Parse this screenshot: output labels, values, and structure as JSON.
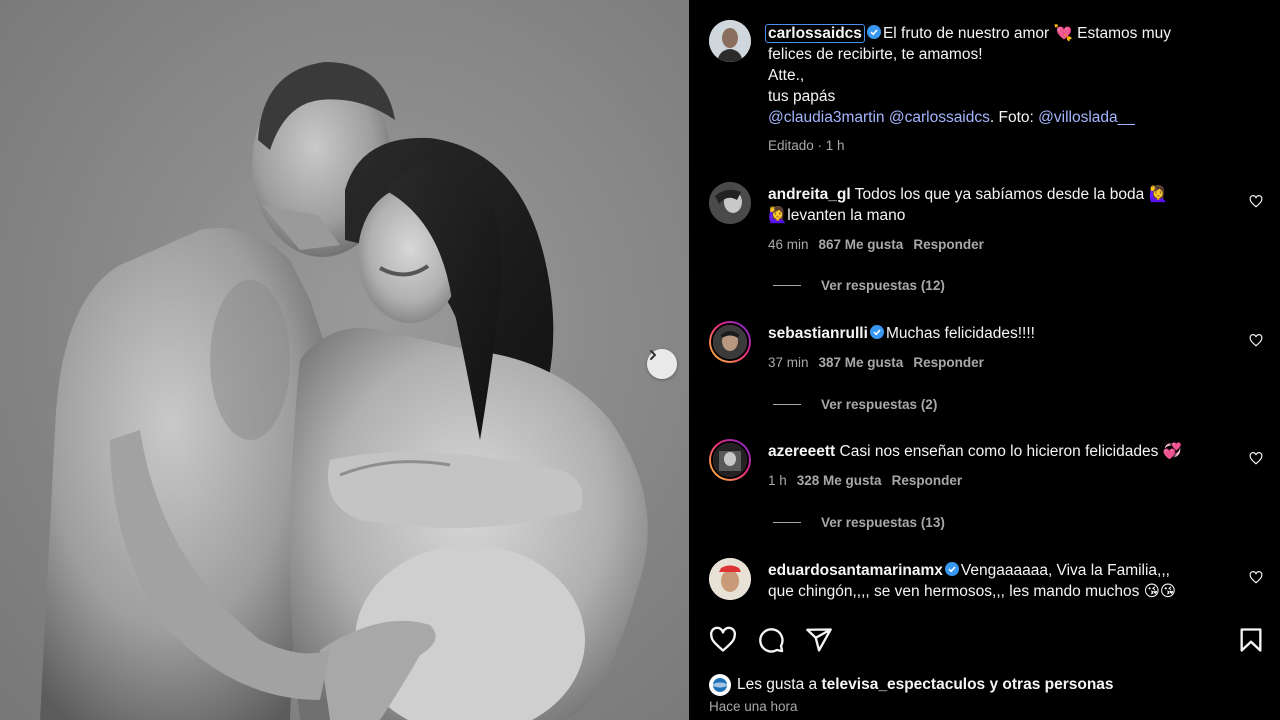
{
  "post": {
    "author": "carlossaidcs",
    "caption_lines": [
      "El fruto de nuestro amor 💘 Estamos muy",
      "felices de recibirte, te amamos!",
      "Atte.,",
      "tus papás"
    ],
    "mentions": [
      "@claudia3martin",
      "@carlossaidcs",
      "@villoslada__"
    ],
    "photo_credit_label": "Foto:",
    "caption_meta": "Editado · 1 h"
  },
  "comments": [
    {
      "username": "andreita_gl",
      "verified": false,
      "text_line1": "Todos los que ya sabíamos desde la boda 🙋‍♀️",
      "text_line2": "🙋‍♀️levanten la mano",
      "time": "46 min",
      "likes": "867 Me gusta",
      "reply_label": "Responder",
      "view_replies": "Ver respuestas (12)"
    },
    {
      "username": "sebastianrulli",
      "verified": true,
      "text_line1": "Muchas felicidades!!!!",
      "time": "37 min",
      "likes": "387 Me gusta",
      "reply_label": "Responder",
      "view_replies": "Ver respuestas (2)"
    },
    {
      "username": "azereeett",
      "verified": false,
      "text_line1": "Casi nos enseñan como lo hicieron felicidades 💞",
      "time": "1 h",
      "likes": "328 Me gusta",
      "reply_label": "Responder",
      "view_replies": "Ver respuestas (13)"
    },
    {
      "username": "eduardosantamarinamx",
      "verified": true,
      "text_line1": "Vengaaaaaa, Viva la Familia,,,",
      "text_line2": "que chingón,,,, se ven hermosos,,, les mando muchos 😘😘"
    }
  ],
  "footer": {
    "likes_prefix": "Les gusta a",
    "likes_user": "televisa_espectaculos",
    "likes_suffix": "y otras personas",
    "time": "Hace una hora"
  },
  "icons": {
    "like": "heart-icon",
    "comment": "comment-icon",
    "share": "share-icon",
    "save": "bookmark-icon",
    "next": "chevron-right-icon",
    "verified": "verified-badge-icon"
  },
  "colors": {
    "panel_bg": "#000000",
    "mention": "#a4b6ff",
    "verified": "#3897f0",
    "muted": "#a8a8a8"
  }
}
